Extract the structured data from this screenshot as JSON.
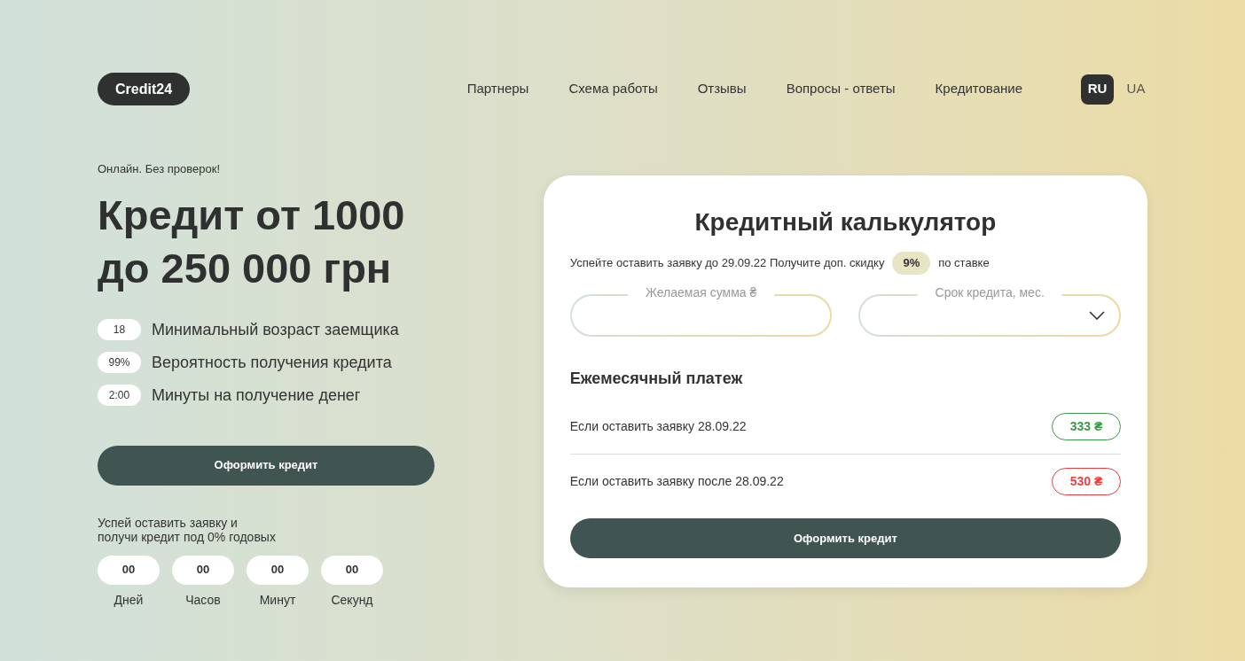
{
  "header": {
    "logo": "Credit24",
    "nav": [
      "Партнеры",
      "Схема работы",
      "Отзывы",
      "Вопросы - ответы",
      "Кредитование"
    ],
    "languages": [
      {
        "label": "RU",
        "selected": true
      },
      {
        "label": "UA",
        "selected": false
      }
    ]
  },
  "hero": {
    "tagline": "Онлайн. Без проверок!",
    "title_lines": [
      "Кредит от 1000",
      "до 250 000 грн"
    ],
    "facts": [
      {
        "value": "18",
        "label": "Минимальный возраст заемщика"
      },
      {
        "value": "99%",
        "label": "Вероятность получения кредита"
      },
      {
        "value": "2:00",
        "label": "Минуты на получение денег"
      }
    ],
    "button": "Оформить кредит",
    "promo_lines": [
      "Успей оставить заявку и",
      "получи кредит под 0% годовых"
    ],
    "countdown": [
      {
        "value": "00",
        "label": "Дней"
      },
      {
        "value": "00",
        "label": "Часов"
      },
      {
        "value": "00",
        "label": "Минут"
      },
      {
        "value": "00",
        "label": "Секунд"
      }
    ]
  },
  "calculator": {
    "title": "Кредитный калькулятор",
    "notice_before": "Успейте оставить заявку до 29.09.22 Получите доп. скидку",
    "discount": "9%",
    "notice_after": "по ставке",
    "fields": [
      {
        "kind": "input",
        "label": "Желаемая сумма ₴"
      },
      {
        "kind": "select",
        "label": "Срок кредита, мес."
      }
    ],
    "payment_title": "Ежемесячный платеж",
    "payments": [
      {
        "label": "Если оставить заявку 28.09.22",
        "amount": "333 ₴",
        "color": "#3a9a4a"
      },
      {
        "label": "Если оставить заявку после 28.09.22",
        "amount": "530 ₴",
        "color": "#f03c3c"
      }
    ],
    "button": "Оформить кредит"
  }
}
